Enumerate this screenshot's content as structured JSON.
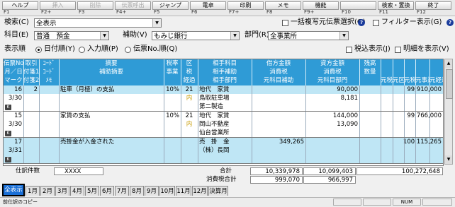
{
  "toolbar": {
    "keys": [
      {
        "label": "ヘルプ",
        "num": "F1",
        "disabled": false
      },
      {
        "label": "挿入",
        "num": "F2+",
        "disabled": true
      },
      {
        "label": "削除",
        "num": "F3",
        "disabled": true
      },
      {
        "label": "伝票呼出",
        "num": "F4+",
        "disabled": true
      },
      {
        "label": "ジャンプ",
        "num": "F5",
        "disabled": false
      },
      {
        "label": "電卓",
        "num": "F6",
        "disabled": false
      },
      {
        "label": "印刷",
        "num": "F7+",
        "disabled": false
      },
      {
        "label": "メモ",
        "num": "F8",
        "disabled": false
      },
      {
        "label": "機能",
        "num": "F9+",
        "disabled": false
      },
      {
        "label": "",
        "num": "F10",
        "disabled": true
      },
      {
        "label": "検索・置換",
        "num": "F11",
        "disabled": false
      },
      {
        "label": "終了",
        "num": "F12",
        "disabled": false
      }
    ]
  },
  "filters": {
    "search_label": "検索(C)",
    "search_value": "全表示",
    "batch_copy_label": "一括複写元伝票選択(Q)",
    "filter_display_label": "フィルター表示(G)",
    "account_label": "科目(E)",
    "account_value": "普通　預金",
    "sub_label": "補助(V)",
    "sub_value": "もみじ銀行",
    "dept_label": "部門(R)",
    "dept_value": "全事業所",
    "order_label": "表示順",
    "order_options": [
      "日付順(Y)",
      "入力順(P)",
      "伝票No.順(Q)"
    ],
    "order_selected": 0,
    "tax_display_label": "税込表示(J)",
    "detail_display_label": "明細を表示(V)"
  },
  "grid": {
    "headers": {
      "c0": [
        "伝票No.",
        "月／日",
        "マーク"
      ],
      "c1": [
        "取引",
        "付箋1",
        "付箋2"
      ],
      "c2": [
        "ｺｰﾄﾞ",
        "ｺｰﾄﾞ",
        "ﾒﾓ"
      ],
      "c3": [
        "摘要",
        "補助摘要",
        ""
      ],
      "c4": [
        "税率",
        "事業",
        ""
      ],
      "c5": [
        "区",
        "税",
        "経過"
      ],
      "c6": [
        "相手科目",
        "相手補助",
        "相手部門"
      ],
      "c7": [
        "借方金額",
        "消費税",
        "元科目補助"
      ],
      "c8": [
        "貸方金額",
        "消費税",
        "元科目部門"
      ],
      "c9": [
        "残高",
        "数量",
        ""
      ],
      "c10": [
        "元税率"
      ],
      "c11": [
        "元区"
      ],
      "c12": [
        "元税"
      ],
      "c13": [
        "元事業"
      ],
      "c14": [
        "元経過"
      ]
    },
    "rows": [
      {
        "no": "16",
        "date": "3/30",
        "mark": "K",
        "torihiki": "2",
        "tekiyo": "駐車（月極）の支払",
        "rate": "10%",
        "ku": "21",
        "zei": "内",
        "acct": "地代　家賃",
        "sub": "鳥取駐車場",
        "dept": "第二製造",
        "debit": "",
        "debit_tax": "",
        "credit": "90,000",
        "credit_tax": "8,181",
        "balance": "99,910,000"
      },
      {
        "no": "15",
        "date": "3/30",
        "mark": "K",
        "torihiki": "",
        "tekiyo": "家賃の支払",
        "rate": "10%",
        "ku": "21",
        "zei": "内",
        "acct": "地代　家賃",
        "sub": "岡山不動産",
        "dept": "仙台営業所",
        "debit": "",
        "debit_tax": "",
        "credit": "144,000",
        "credit_tax": "13,090",
        "balance": "99,766,000"
      },
      {
        "no": "17",
        "date": "3/31",
        "mark": "K",
        "torihiki": "",
        "tekiyo": "売掛金が入金された",
        "rate": "",
        "ku": "",
        "zei": "",
        "acct": "売　掛　金",
        "sub": "（株）長岡",
        "dept": "",
        "debit": "349,265",
        "debit_tax": "",
        "credit": "",
        "credit_tax": "",
        "balance": "100,115,265"
      }
    ]
  },
  "totals": {
    "count_label": "仕訳件数",
    "count_value": "XXXX",
    "total_label": "合計",
    "tax_total_label": "消費税合計",
    "debit_total": "10,339,978",
    "credit_total": "10,099,403",
    "balance_total": "100,272,648",
    "debit_tax_total": "999,070",
    "credit_tax_total": "966,997"
  },
  "tabs": [
    "全表示",
    "1月",
    "2月",
    "3月",
    "4月",
    "5月",
    "6月",
    "7月",
    "8月",
    "9月",
    "10月",
    "11月",
    "12月",
    "決算月"
  ],
  "active_tab": 0,
  "status": {
    "text": "前仕訳のコピー",
    "num": "NUM"
  },
  "colors": {
    "header": "#2f9bd6",
    "row_highlight": "#bfe6f5",
    "active_tab": "#1a6fd6"
  }
}
